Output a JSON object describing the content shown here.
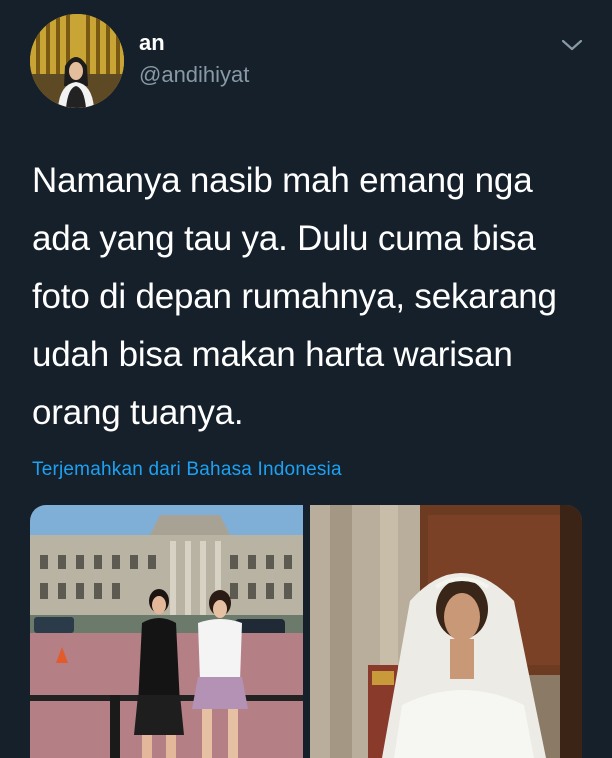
{
  "tweet": {
    "author_name": "an",
    "author_handle": "@andihiyat",
    "text": "Namanya nasib mah emang nga ada yang tau ya. Dulu cuma bisa foto di depan rumahnya, sekarang udah bisa makan harta warisan orang tuanya.",
    "translate_link": "Terjemahkan dari Bahasa Indonesia"
  },
  "icons": {
    "menu": "chevron-down-icon"
  },
  "colors": {
    "background": "#15202b",
    "primary_text": "#ffffff",
    "secondary_text": "#8899a6",
    "link": "#1da1f2"
  }
}
